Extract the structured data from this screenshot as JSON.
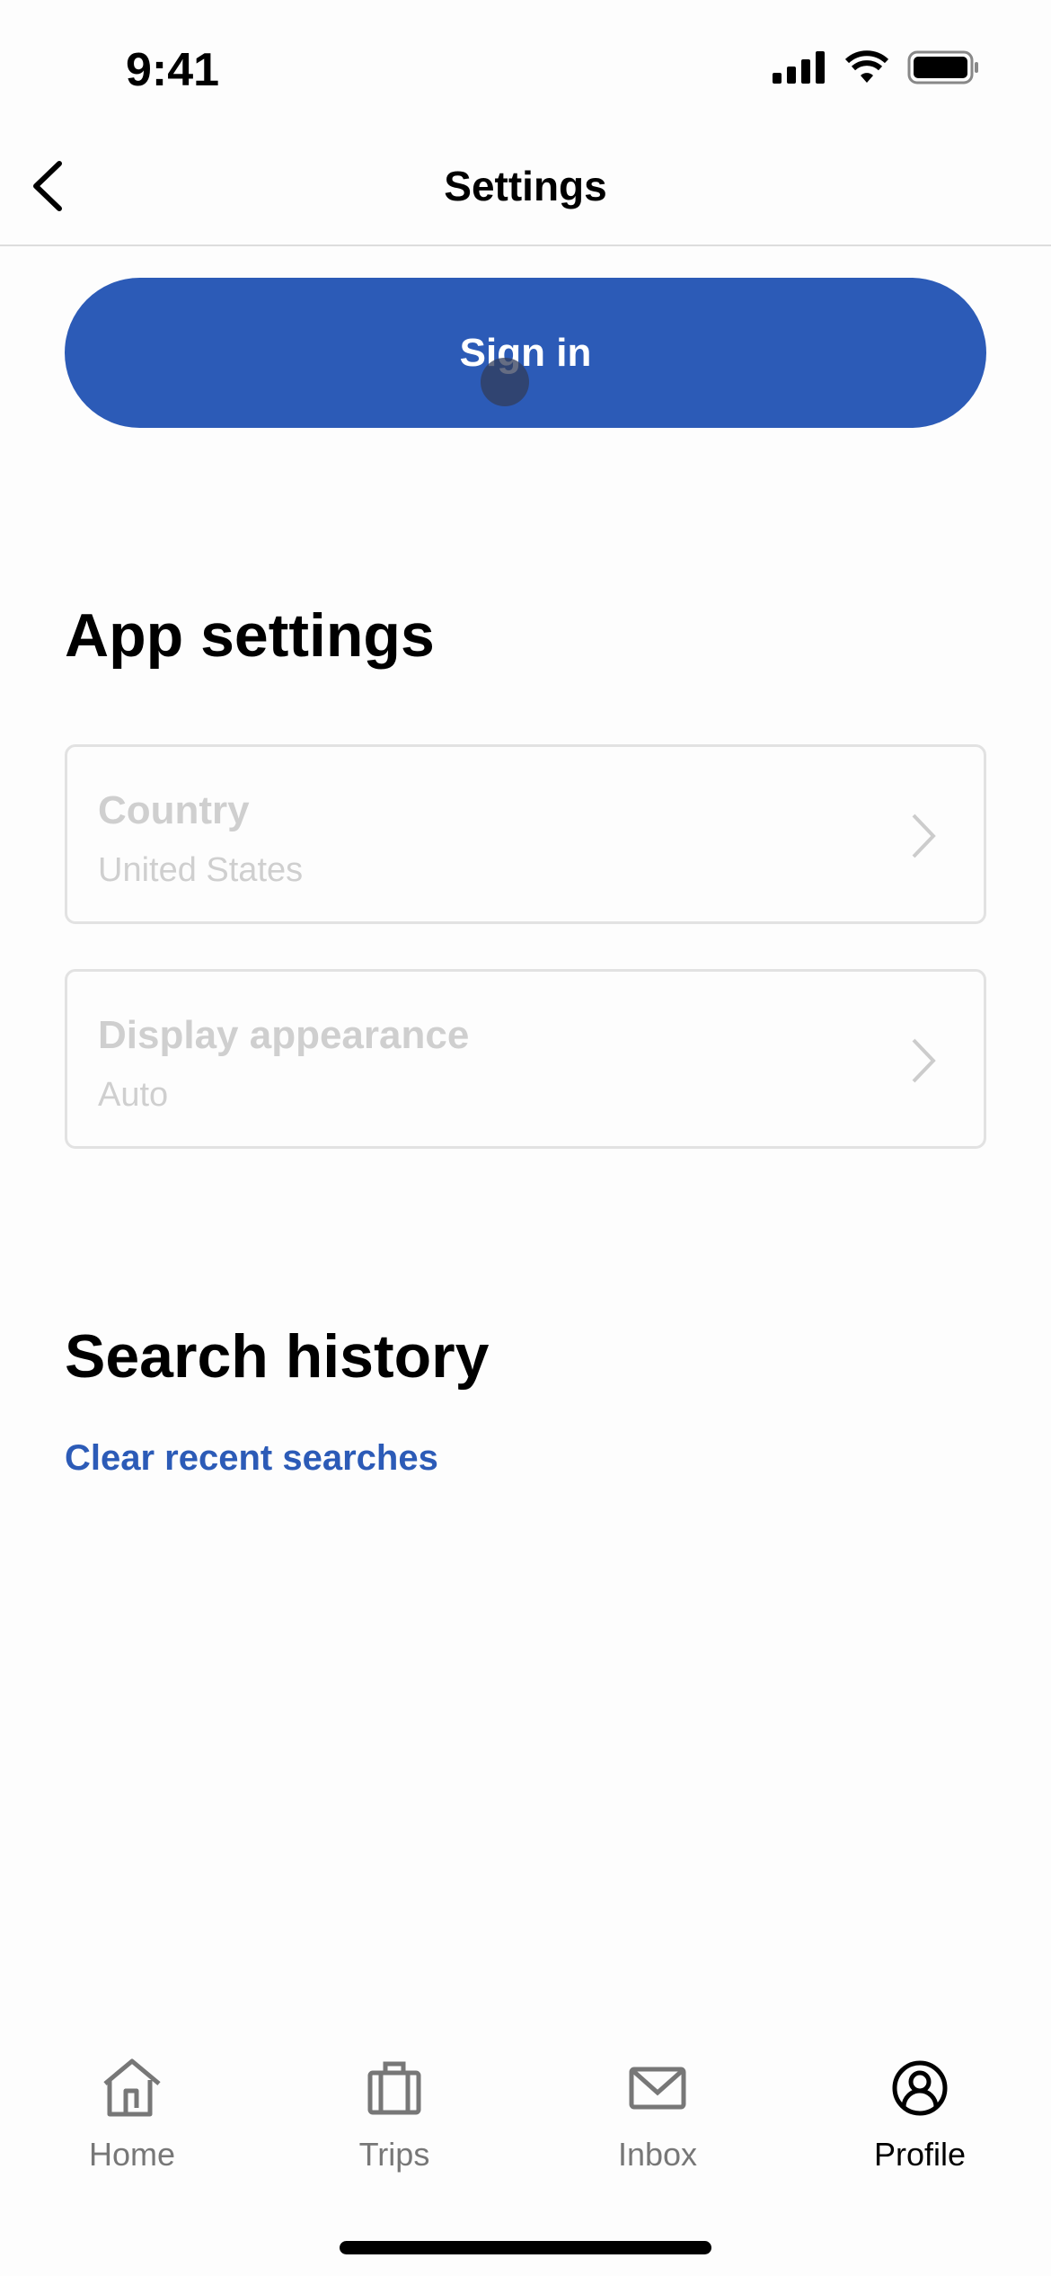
{
  "status_bar": {
    "time": "9:41"
  },
  "header": {
    "title": "Settings",
    "back_icon": "chevron-left-icon"
  },
  "sign_in": {
    "label": "Sign in",
    "color": "#2c5bb7"
  },
  "app_settings": {
    "heading": "App settings",
    "items": [
      {
        "title": "Country",
        "value": "United States"
      },
      {
        "title": "Display appearance",
        "value": "Auto"
      }
    ]
  },
  "search_history": {
    "heading": "Search history",
    "clear_label": "Clear recent searches"
  },
  "tab_bar": {
    "active": "Profile",
    "items": [
      {
        "label": "Home",
        "icon": "home-icon"
      },
      {
        "label": "Trips",
        "icon": "suitcase-icon"
      },
      {
        "label": "Inbox",
        "icon": "mail-icon"
      },
      {
        "label": "Profile",
        "icon": "profile-icon"
      }
    ]
  }
}
